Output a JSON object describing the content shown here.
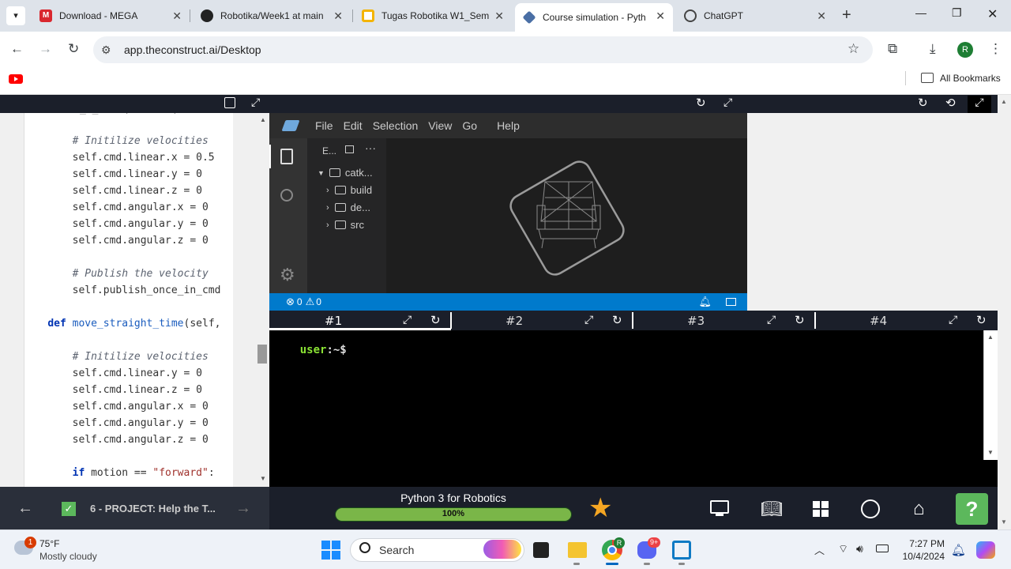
{
  "browser": {
    "tabs": [
      {
        "title": "Download - MEGA",
        "icon": "mega-icon",
        "color": "#d9272e"
      },
      {
        "title": "Robotika/Week1 at main",
        "icon": "github-icon",
        "color": "#222222"
      },
      {
        "title": "Tugas Robotika W1_Sem",
        "icon": "slides-icon",
        "color": "#f4b400"
      },
      {
        "title": "Course simulation - Pyth",
        "icon": "theconstruct-icon",
        "color": "#4a6fa5"
      },
      {
        "title": "ChatGPT",
        "icon": "chatgpt-icon",
        "color": "#444444"
      }
    ],
    "url": "app.theconstruct.ai/Desktop",
    "bookmarks_label": "All Bookmarks",
    "profile_initial": "R"
  },
  "editor": {
    "lines": [
      {
        "text": "        # Initilize velocities",
        "kind": "cm"
      },
      {
        "text": "        self.cmd.linear.x = 0.5",
        "kind": "code"
      },
      {
        "text": "        self.cmd.linear.y = 0",
        "kind": "code"
      },
      {
        "text": "        self.cmd.linear.z = 0",
        "kind": "code"
      },
      {
        "text": "        self.cmd.angular.x = 0",
        "kind": "code"
      },
      {
        "text": "        self.cmd.angular.y = 0",
        "kind": "code"
      },
      {
        "text": "        self.cmd.angular.z = 0",
        "kind": "code"
      },
      {
        "text": "",
        "kind": "code"
      },
      {
        "text": "        # Publish the velocity",
        "kind": "cm"
      },
      {
        "text": "        self.publish_once_in_cmd",
        "kind": "code"
      },
      {
        "text": "",
        "kind": "code"
      },
      {
        "text": "    def move_straight_time(self,",
        "kind": "def"
      },
      {
        "text": "",
        "kind": "code"
      },
      {
        "text": "        # Initilize velocities",
        "kind": "cm"
      },
      {
        "text": "        self.cmd.linear.y = 0",
        "kind": "code"
      },
      {
        "text": "        self.cmd.linear.z = 0",
        "kind": "code"
      },
      {
        "text": "        self.cmd.angular.x = 0",
        "kind": "code"
      },
      {
        "text": "        self.cmd.angular.y = 0",
        "kind": "code"
      },
      {
        "text": "        self.cmd.angular.z = 0",
        "kind": "code"
      },
      {
        "text": "",
        "kind": "code"
      },
      {
        "text": "        if motion == \"forward\":",
        "kind": "if"
      }
    ]
  },
  "vscode": {
    "menu": [
      "File",
      "Edit",
      "Selection",
      "View",
      "Go",
      "Help"
    ],
    "explorer_title": "E...",
    "root_folder": "catk...",
    "folders": [
      "build",
      "de...",
      "src"
    ],
    "errors": "0",
    "warnings": "0"
  },
  "terminal": {
    "tabs": [
      "#1",
      "#2",
      "#3",
      "#4"
    ],
    "prompt_user": "user",
    "prompt_suffix": ":~$"
  },
  "course": {
    "current_unit": "6 - PROJECT: Help the T...",
    "title": "Python 3 for Robotics",
    "progress_label": "100%",
    "progress": 1.0
  },
  "taskbar": {
    "weather_temp": "75°F",
    "weather_desc": "Mostly cloudy",
    "weather_badge": "1",
    "search_placeholder": "Search",
    "time": "7:27 PM",
    "date": "10/4/2024",
    "discord_badge": "9+",
    "chrome_badge": "R"
  }
}
